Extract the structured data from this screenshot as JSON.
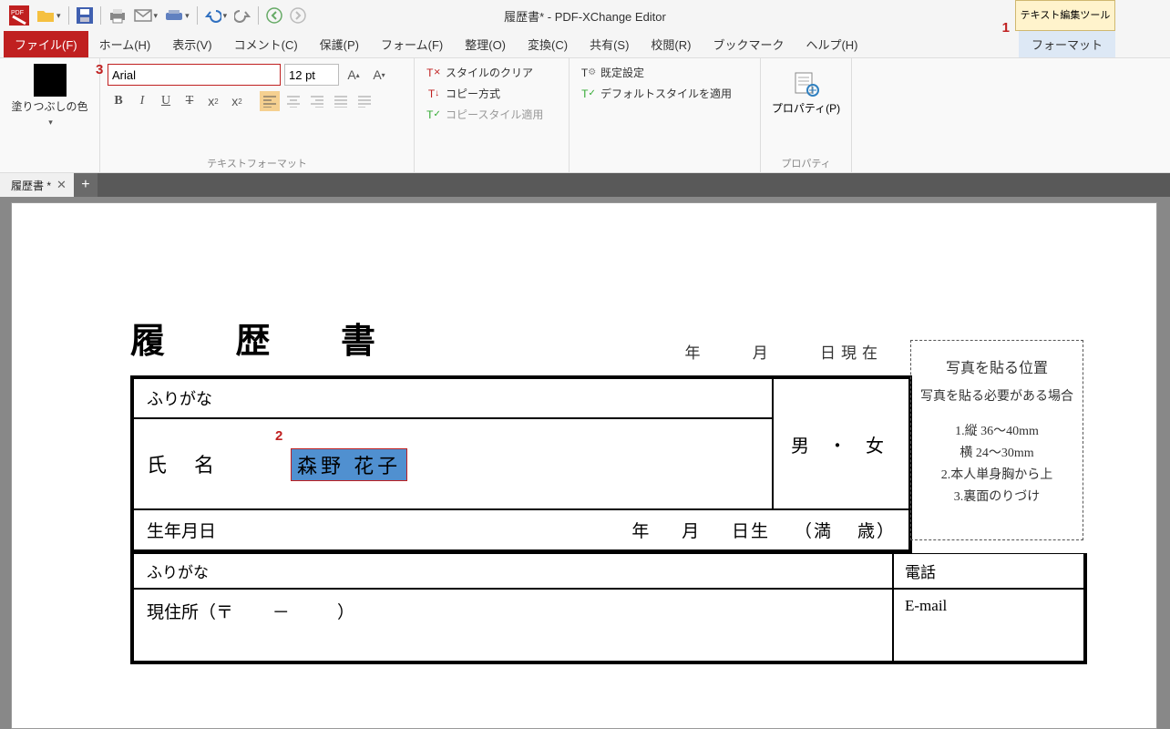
{
  "window_title": "履歴書* - PDF-XChange Editor",
  "text_edit_tool_label": "テキスト編集ツール",
  "markers": {
    "m1": "1",
    "m2": "2",
    "m3": "3"
  },
  "menu": {
    "file": "ファイル(F)",
    "home": "ホーム(H)",
    "view": "表示(V)",
    "comment": "コメント(C)",
    "protect": "保護(P)",
    "form": "フォーム(F)",
    "organize": "整理(O)",
    "convert": "変換(C)",
    "share": "共有(S)",
    "review": "校閲(R)",
    "bookmark": "ブックマーク",
    "help": "ヘルプ(H)",
    "format": "フォーマット"
  },
  "ribbon": {
    "fill_color_label": "塗りつぶしの色",
    "font_name": "Arial",
    "font_size": "12 pt",
    "textformat_label": "テキストフォーマット",
    "clear_style": "スタイルのクリア",
    "copy_method": "コピー方式",
    "copy_style_apply": "コピースタイル適用",
    "default_settings": "既定設定",
    "default_style_apply": "デフォルトスタイルを適用",
    "properties_btn": "プロパティ(P)",
    "properties_label": "プロパティ"
  },
  "tab": {
    "name": "履歴書 *"
  },
  "doc": {
    "title": "履 歴 書",
    "date_year": "年",
    "date_month": "月",
    "date_day_current": "日現在",
    "furigana": "ふりがな",
    "name_label_shi": "氏",
    "name_label_mei": "名",
    "selected_name": "森野  花子",
    "gender_m": "男",
    "gender_dot": "・",
    "gender_f": "女",
    "birth_label": "生年月日",
    "birth_year": "年",
    "birth_month": "月",
    "birth_day": "日生",
    "birth_age1": "（満",
    "birth_age2": "歳）",
    "addr_furigana": "ふりがな",
    "addr_label": "現住所（〒",
    "addr_dash": "－",
    "addr_close": "）",
    "phone_label": "電話",
    "email_label": "E-mail",
    "photo": {
      "title": "写真を貼る位置",
      "desc": "写真を貼る必要がある場合",
      "l1": "1.縦  36～40mm",
      "l2": "横  24～30mm",
      "l3": "2.本人単身胸から上",
      "l4": "3.裏面のりづけ"
    }
  }
}
